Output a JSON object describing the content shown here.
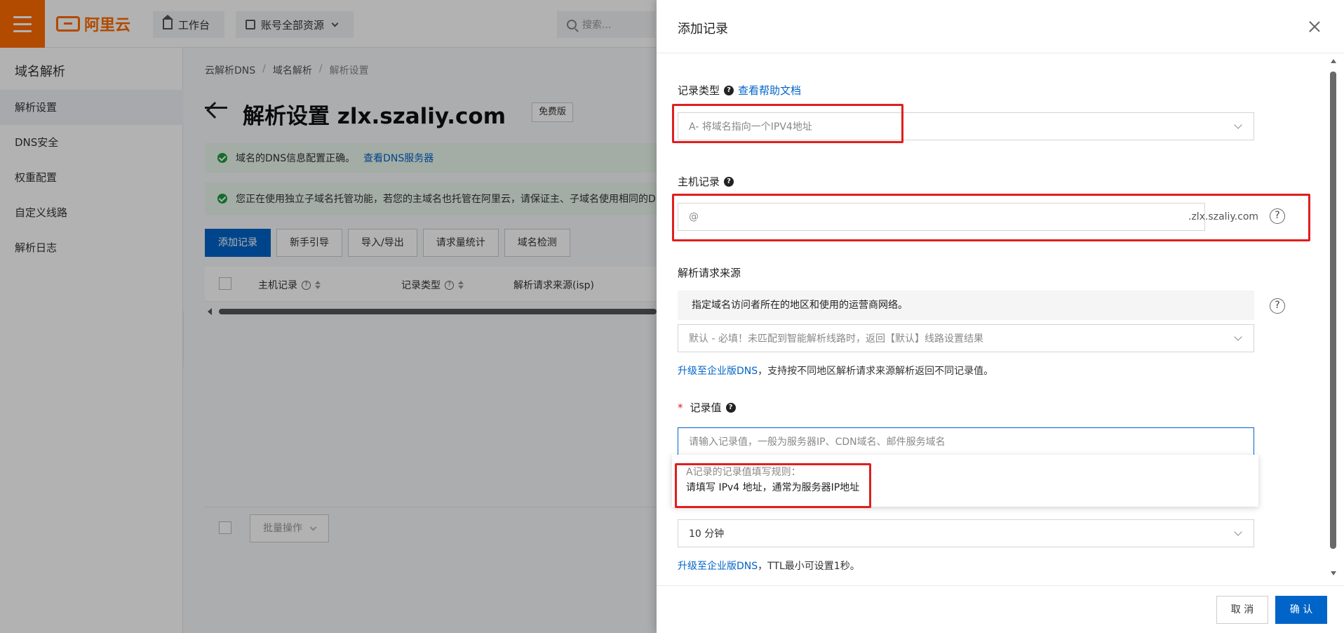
{
  "header": {
    "logo_text": "阿里云",
    "workbench_label": "工作台",
    "resources_label": "账号全部资源",
    "search_placeholder": "搜索..."
  },
  "sidebar": {
    "title": "域名解析",
    "items": [
      {
        "label": "解析设置",
        "active": true
      },
      {
        "label": "DNS安全",
        "active": false
      },
      {
        "label": "权重配置",
        "active": false
      },
      {
        "label": "自定义线路",
        "active": false
      },
      {
        "label": "解析日志",
        "active": false
      }
    ]
  },
  "main": {
    "breadcrumb": [
      "云解析DNS",
      "域名解析",
      "解析设置"
    ],
    "breadcrumb_sep": "/",
    "title": "解析设置 zlx.szaliy.com",
    "badge": "免费版",
    "alert1": {
      "text": "域名的DNS信息配置正确。",
      "link": "查看DNS服务器"
    },
    "alert2": {
      "text": "您正在使用独立子域名托管功能，若您的主域名也托管在阿里云，请保证主、子域名使用相同的DNS服务器"
    },
    "buttons": [
      "添加记录",
      "新手引导",
      "导入/导出",
      "请求量统计",
      "域名检测"
    ],
    "columns": [
      "主机记录",
      "记录类型",
      "解析请求来源(isp)"
    ],
    "batch_label": "批量操作"
  },
  "drawer": {
    "title": "添加记录",
    "record_type": {
      "label": "记录类型",
      "help_link": "查看帮助文档",
      "value": "A- 将域名指向一个IPV4地址"
    },
    "host": {
      "label": "主机记录",
      "value": "@",
      "suffix": ".zlx.szaliy.com"
    },
    "source": {
      "label": "解析请求来源",
      "hint": "指定域名访问者所在的地区和使用的运营商网络。",
      "value": "默认 - 必填！未匹配到智能解析线路时，返回【默认】线路设置结果",
      "upgrade_link": "升级至企业版DNS",
      "upgrade_note": "，支持按不同地区解析请求来源解析返回不同记录值。"
    },
    "record_value": {
      "required_mark": "*",
      "label": "记录值",
      "placeholder": "请输入记录值，一般为服务器IP、CDN域名、邮件服务域名"
    },
    "popover": {
      "line1": "A记录的记录值填写规则：",
      "line2": "请填写 IPv4 地址，通常为服务器IP地址"
    },
    "ttl": {
      "value": "10 分钟",
      "upgrade_link": "升级至企业版DNS",
      "upgrade_note": "，TTL最小可设置1秒。"
    },
    "cancel_label": "取 消",
    "confirm_label": "确 认"
  },
  "colors": {
    "brand_orange": "#ff6a00",
    "primary_blue": "#0064c8",
    "highlight_red": "#e01e1e",
    "success_green": "#1e9c3b"
  }
}
